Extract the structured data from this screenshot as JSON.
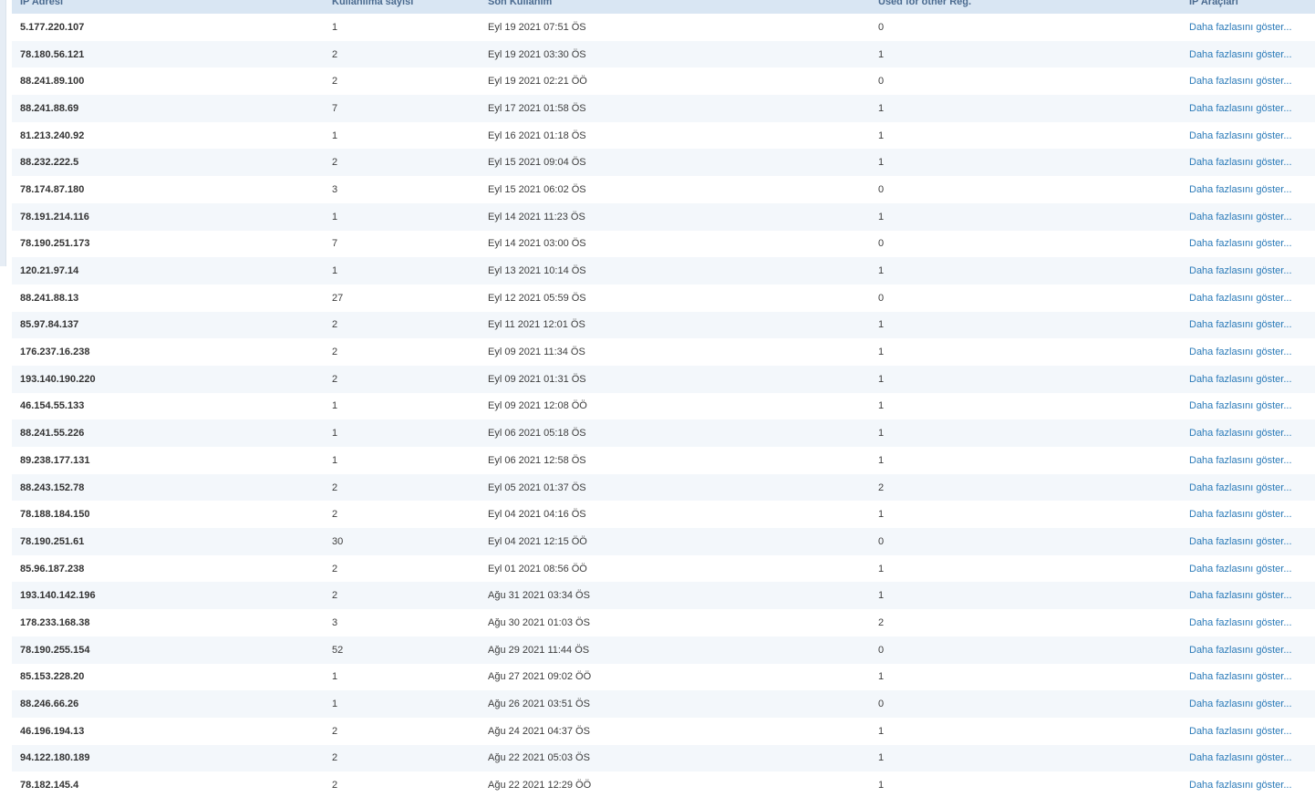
{
  "table": {
    "headers": {
      "ip": "IP Adresi",
      "count": "Kullanılma sayısı",
      "last": "Son Kullanım",
      "other": "Used for other Reg.",
      "tools": "IP Araçları"
    },
    "link_label": "Daha fazlasını göster...",
    "rows": [
      {
        "ip": "5.177.220.107",
        "count": "1",
        "last": "Eyl 19 2021 07:51 ÖS",
        "other": "0"
      },
      {
        "ip": "78.180.56.121",
        "count": "2",
        "last": "Eyl 19 2021 03:30 ÖS",
        "other": "1"
      },
      {
        "ip": "88.241.89.100",
        "count": "2",
        "last": "Eyl 19 2021 02:21 ÖÖ",
        "other": "0"
      },
      {
        "ip": "88.241.88.69",
        "count": "7",
        "last": "Eyl 17 2021 01:58 ÖS",
        "other": "1"
      },
      {
        "ip": "81.213.240.92",
        "count": "1",
        "last": "Eyl 16 2021 01:18 ÖS",
        "other": "1"
      },
      {
        "ip": "88.232.222.5",
        "count": "2",
        "last": "Eyl 15 2021 09:04 ÖS",
        "other": "1"
      },
      {
        "ip": "78.174.87.180",
        "count": "3",
        "last": "Eyl 15 2021 06:02 ÖS",
        "other": "0"
      },
      {
        "ip": "78.191.214.116",
        "count": "1",
        "last": "Eyl 14 2021 11:23 ÖS",
        "other": "1"
      },
      {
        "ip": "78.190.251.173",
        "count": "7",
        "last": "Eyl 14 2021 03:00 ÖS",
        "other": "0"
      },
      {
        "ip": "120.21.97.14",
        "count": "1",
        "last": "Eyl 13 2021 10:14 ÖS",
        "other": "1"
      },
      {
        "ip": "88.241.88.13",
        "count": "27",
        "last": "Eyl 12 2021 05:59 ÖS",
        "other": "0"
      },
      {
        "ip": "85.97.84.137",
        "count": "2",
        "last": "Eyl 11 2021 12:01 ÖS",
        "other": "1"
      },
      {
        "ip": "176.237.16.238",
        "count": "2",
        "last": "Eyl 09 2021 11:34 ÖS",
        "other": "1"
      },
      {
        "ip": "193.140.190.220",
        "count": "2",
        "last": "Eyl 09 2021 01:31 ÖS",
        "other": "1"
      },
      {
        "ip": "46.154.55.133",
        "count": "1",
        "last": "Eyl 09 2021 12:08 ÖÖ",
        "other": "1"
      },
      {
        "ip": "88.241.55.226",
        "count": "1",
        "last": "Eyl 06 2021 05:18 ÖS",
        "other": "1"
      },
      {
        "ip": "89.238.177.131",
        "count": "1",
        "last": "Eyl 06 2021 12:58 ÖS",
        "other": "1"
      },
      {
        "ip": "88.243.152.78",
        "count": "2",
        "last": "Eyl 05 2021 01:37 ÖS",
        "other": "2"
      },
      {
        "ip": "78.188.184.150",
        "count": "2",
        "last": "Eyl 04 2021 04:16 ÖS",
        "other": "1"
      },
      {
        "ip": "78.190.251.61",
        "count": "30",
        "last": "Eyl 04 2021 12:15 ÖÖ",
        "other": "0"
      },
      {
        "ip": "85.96.187.238",
        "count": "2",
        "last": "Eyl 01 2021 08:56 ÖÖ",
        "other": "1"
      },
      {
        "ip": "193.140.142.196",
        "count": "2",
        "last": "Ağu 31 2021 03:34 ÖS",
        "other": "1"
      },
      {
        "ip": "178.233.168.38",
        "count": "3",
        "last": "Ağu 30 2021 01:03 ÖS",
        "other": "2"
      },
      {
        "ip": "78.190.255.154",
        "count": "52",
        "last": "Ağu 29 2021 11:44 ÖS",
        "other": "0"
      },
      {
        "ip": "85.153.228.20",
        "count": "1",
        "last": "Ağu 27 2021 09:02 ÖÖ",
        "other": "1"
      },
      {
        "ip": "88.246.66.26",
        "count": "1",
        "last": "Ağu 26 2021 03:51 ÖS",
        "other": "0"
      },
      {
        "ip": "46.196.194.13",
        "count": "2",
        "last": "Ağu 24 2021 04:37 ÖS",
        "other": "1"
      },
      {
        "ip": "94.122.180.189",
        "count": "2",
        "last": "Ağu 22 2021 05:03 ÖS",
        "other": "1"
      },
      {
        "ip": "78.182.145.4",
        "count": "2",
        "last": "Ağu 22 2021 12:29 ÖÖ",
        "other": "1"
      }
    ]
  }
}
